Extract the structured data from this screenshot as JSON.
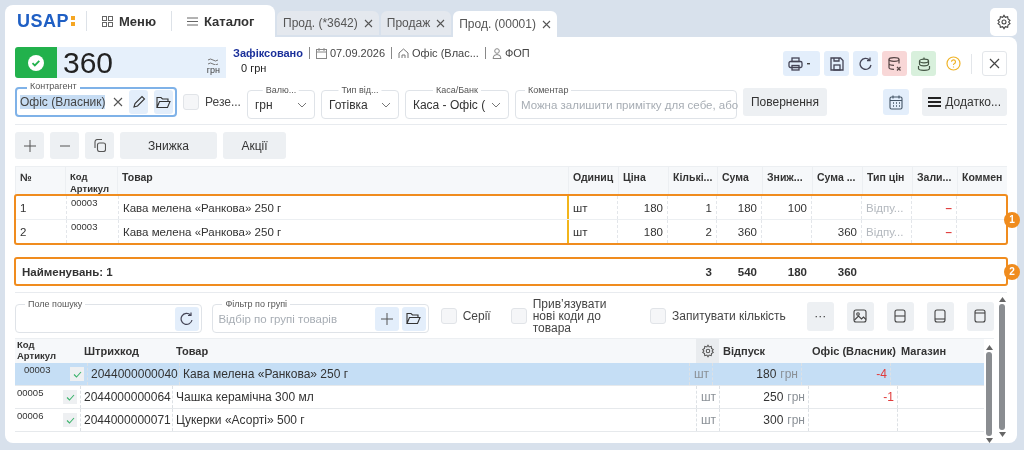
{
  "brand": {
    "logo": "USAP"
  },
  "nav": [
    {
      "kind": "menu",
      "label": "Меню"
    },
    {
      "kind": "catalog",
      "label": "Каталог"
    }
  ],
  "tabs": [
    {
      "label": "Прод. (*3642)",
      "selected": false
    },
    {
      "label": "Продаж",
      "selected": false
    },
    {
      "label": "Прод. (00001)",
      "selected": true
    }
  ],
  "document": {
    "posted": true,
    "amount": "360",
    "currency": "грн",
    "status": "Зафіксовано",
    "date": "07.09.2026",
    "warehouse": "Офіс (Влас...",
    "organization": "ФОП",
    "balance": "0 грн"
  },
  "counterparty": {
    "label": "Контрагент",
    "value": "Офіс (Власник)"
  },
  "reserve": {
    "label": "Резе...",
    "checked": false
  },
  "selects": [
    {
      "label": "Валю...",
      "value": "грн"
    },
    {
      "label": "Тип від...",
      "value": "Готівка"
    },
    {
      "label": "Каса/Банк",
      "value": "Каса - Офіс ("
    }
  ],
  "comment": {
    "label": "Коментар",
    "placeholder": "Можна залишити примітку для себе, або"
  },
  "return_button": "Повернення",
  "more_button": "Додатко...",
  "row_actions": [
    "Знижка",
    "Акції"
  ],
  "items_table": {
    "columns": [
      "№",
      "Код Артикул",
      "Товар",
      "Одиниц",
      "Ціна",
      "Кількі...",
      "Сума",
      "Зниж...",
      "Сума ...",
      "Тип цін",
      "Зали...",
      "Коммен"
    ],
    "badge": "1",
    "rows": [
      {
        "no": "1",
        "code": "00003",
        "product": "Кава мелена «Ранкова» 250 г",
        "unit": "шт",
        "price": "180",
        "qty": "1",
        "sum": "180",
        "discount": "100",
        "price_type": "Відпу...",
        "stock": "–"
      },
      {
        "no": "2",
        "code": "00003",
        "product": "Кава мелена «Ранкова» 250 г",
        "unit": "шт",
        "price": "180",
        "qty": "2",
        "sum": "360",
        "total": "360",
        "price_type": "Відпу...",
        "stock": "–"
      }
    ]
  },
  "totals": {
    "label": "Найменувань: 1",
    "qty": "3",
    "sum": "540",
    "discount": "180",
    "total": "360",
    "badge": "2"
  },
  "search": {
    "label": "Поле пошуку"
  },
  "group_filter": {
    "label": "Фільтр по групі",
    "placeholder": "Відбір по групі товарів"
  },
  "options": [
    {
      "label": "Серії",
      "checked": false
    },
    {
      "label": "Прив’язувати нові коди до товара",
      "checked": false
    },
    {
      "label": "Запитувати кількість",
      "checked": false
    }
  ],
  "more": "···",
  "catalog_table": {
    "columns": [
      "Код Артикул",
      "Штрихкод",
      "Товар",
      "Відпуск",
      "Офіс (Власник)",
      "Магазин"
    ],
    "rows": [
      {
        "code": "00003",
        "checked": true,
        "barcode": "2044000000040",
        "product": "Кава мелена «Ранкова» 250 г",
        "unit": "шт",
        "price": "180",
        "currency": "грн",
        "office": "-4",
        "selected": true
      },
      {
        "code": "00005",
        "checked": true,
        "barcode": "2044000000064",
        "product": "Чашка керамічна 300 мл",
        "unit": "шт",
        "price": "250",
        "currency": "грн",
        "office": "-1",
        "selected": false
      },
      {
        "code": "00006",
        "checked": true,
        "barcode": "2044000000071",
        "product": "Цукерки «Асорті» 500 г",
        "unit": "шт",
        "price": "300",
        "currency": "грн",
        "selected": false
      }
    ]
  }
}
